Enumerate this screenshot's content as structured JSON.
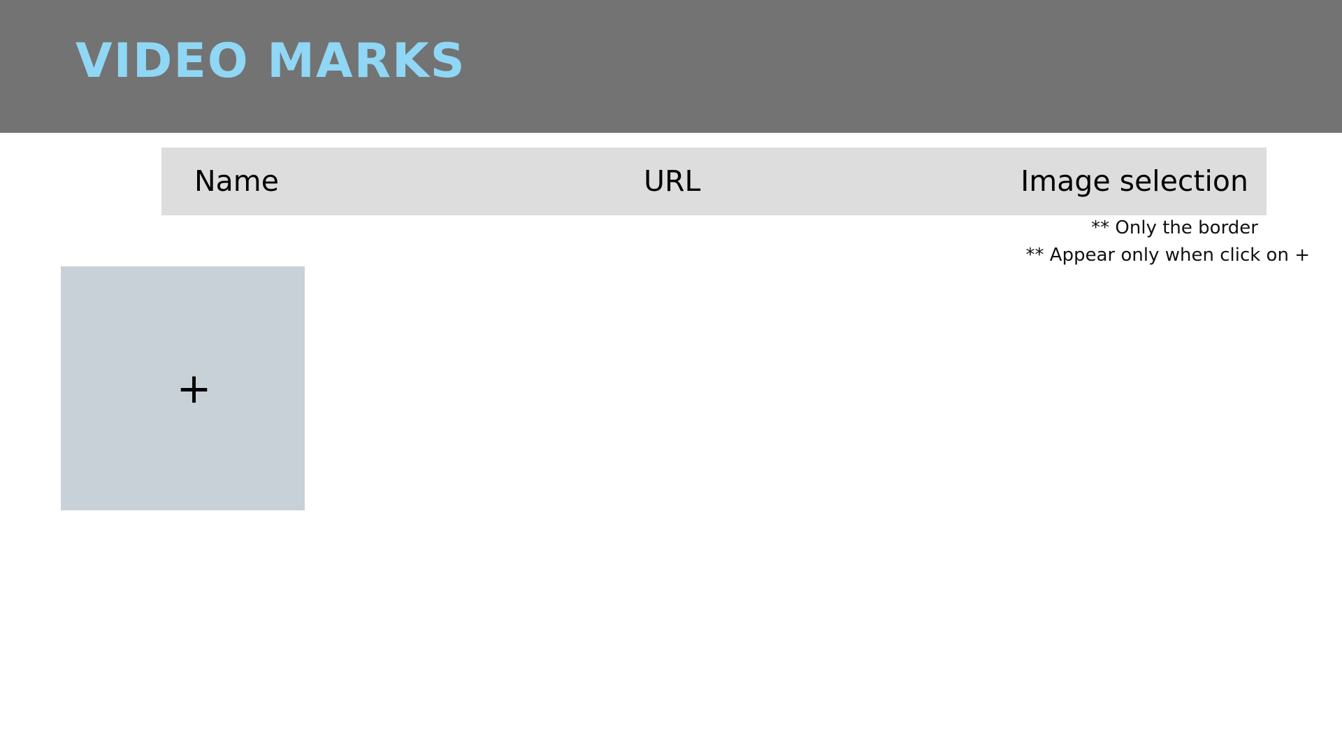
{
  "header": {
    "title": "VIDEO MARKS",
    "title_color": "#8fd7f5",
    "background_color": "#737373"
  },
  "table": {
    "columns": [
      {
        "label": "Name"
      },
      {
        "label": "URL"
      },
      {
        "label": "Image selection"
      }
    ],
    "background_color": "#dddddd"
  },
  "notes": [
    "** Only the border",
    "** Appear only when click on +"
  ],
  "add_tile": {
    "symbol": "+",
    "icon": "plus-icon",
    "background_color": "#c8d0d8"
  }
}
